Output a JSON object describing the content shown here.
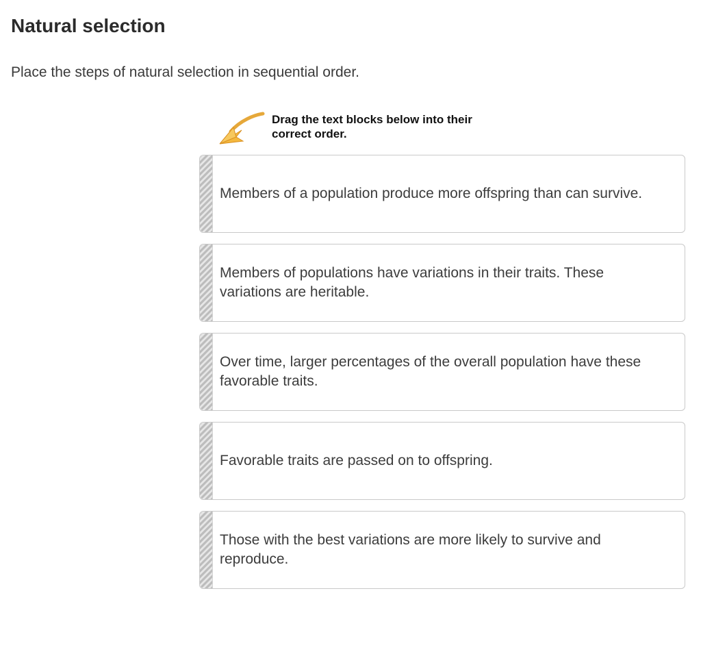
{
  "heading": "Natural selection",
  "instructions": "Place the steps of natural selection in sequential order.",
  "hint": "Drag the text blocks below into their correct order.",
  "items": [
    {
      "text": "Members of a population produce more offspring than can survive."
    },
    {
      "text": "Members of populations have variations in their traits. These variations are heritable."
    },
    {
      "text": "Over time, larger percentages of the overall population have these favorable traits."
    },
    {
      "text": "Favorable traits are passed on to offspring."
    },
    {
      "text": "Those with the best variations are more likely to survive and reproduce."
    }
  ]
}
